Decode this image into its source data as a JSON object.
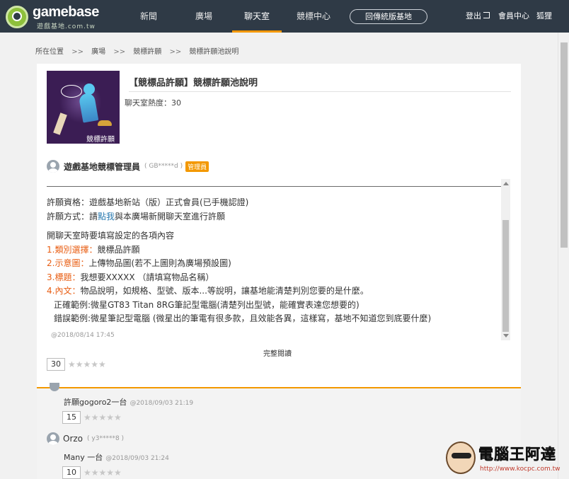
{
  "nav": {
    "logo_text": "gamebase",
    "logo_sub": "遊戲基地.com.tw",
    "items": [
      "新聞",
      "廣場",
      "聊天室",
      "競標中心"
    ],
    "active": "聊天室",
    "pill": "回傳統版基地",
    "logout": "登出",
    "member": "會員中心",
    "user": "狐狸"
  },
  "breadcrumb": [
    "所在位置",
    ">>",
    "廣場",
    ">>",
    "競標許願",
    ">>",
    "競標許願池說明"
  ],
  "room": {
    "title": "【競標品許願】競標許願池說明",
    "heat_label": "聊天室熱度：30",
    "thumb_tag": "競標許願"
  },
  "post": {
    "author": "遊戲基地競標管理員",
    "author_id": "( GB*****d )",
    "badge": "管理員",
    "lines": {
      "l1": "許願資格：遊戲基地新站（版）正式會員(已手機認證)",
      "l2a": "許願方式：請",
      "l2link": "點我",
      "l2b": "與本廣場新開聊天室進行許願",
      "l3": "開聊天室時要填寫設定的各項內容",
      "l4num": "1.類別選擇：",
      "l4": "競標品許願",
      "l5num": "2.示意圖：",
      "l5": "上傳物品圖(若不上圖則為廣場預設圖)",
      "l6num": "3.標題：",
      "l6": "我想要XXXXX （請填寫物品名稱）",
      "l7num": "4.內文：",
      "l7": "物品說明，如規格、型號、版本...等說明，讓基地能清楚判別您要的是什麼。",
      "l8": "正確範例:微星GT83 Titan 8RG筆記型電腦(清楚列出型號，能確實表達您想要的)",
      "l9": "錯誤範例:微星筆記型電腦 (微星出的筆電有很多款，且效能各異，這樣寫，基地不知道您到底要什麼)"
    },
    "date": "@2018/08/14 17:45",
    "read_more": "完整閱讀",
    "score": "30",
    "stars": "★★★★★"
  },
  "comments": [
    {
      "text": "許願gogoro2一台",
      "time": "@2018/09/03 21:19",
      "score": "15",
      "stars": "★★★★★"
    },
    {
      "author": "Orzo",
      "author_id": "( y3*****8 )",
      "text": "Many 一台",
      "time": "@2018/09/03 21:24",
      "score": "10",
      "stars": "★★★★★"
    }
  ],
  "watermark": {
    "text": "電腦王阿達",
    "url": "http://www.kocpc.com.tw"
  }
}
